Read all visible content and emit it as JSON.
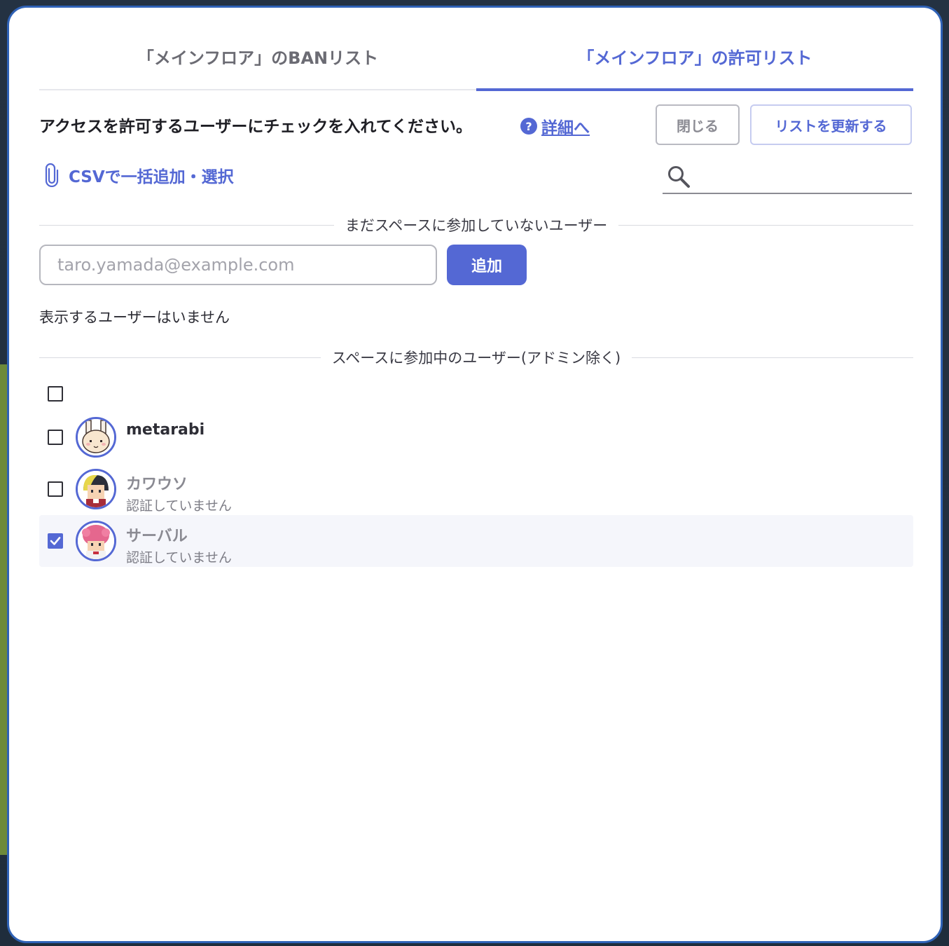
{
  "tabs": [
    {
      "label": "「メインフロア」のBANリスト",
      "active": false
    },
    {
      "label": "「メインフロア」の許可リスト",
      "active": true
    }
  ],
  "instruction": "アクセスを許可するユーザーにチェックを入れてください。",
  "help": {
    "icon": "question-icon",
    "label": "詳細へ"
  },
  "buttons": {
    "close": "閉じる",
    "update": "リストを更新する",
    "add": "追加"
  },
  "csv": {
    "icon": "paperclip-icon",
    "label": "CSVで一括追加・選択"
  },
  "search": {
    "icon": "search-icon",
    "value": ""
  },
  "section_pending": {
    "title": "まだスペースに参加していないユーザー"
  },
  "email": {
    "placeholder": "taro.yamada@example.com",
    "value": ""
  },
  "no_users_text": "表示するユーザーはいません",
  "section_joined": {
    "title": "スペースに参加中のユーザー(アドミン除く)"
  },
  "users": [
    {
      "name": "",
      "status": "",
      "checked": false
    },
    {
      "name": "metarabi",
      "status": "",
      "checked": false
    },
    {
      "name": "カワウソ",
      "status": "認証していません",
      "checked": false
    },
    {
      "name": "サーバル",
      "status": "認証していません",
      "checked": true
    }
  ],
  "colors": {
    "accent": "#5468d4",
    "border": "#2f62b6"
  }
}
